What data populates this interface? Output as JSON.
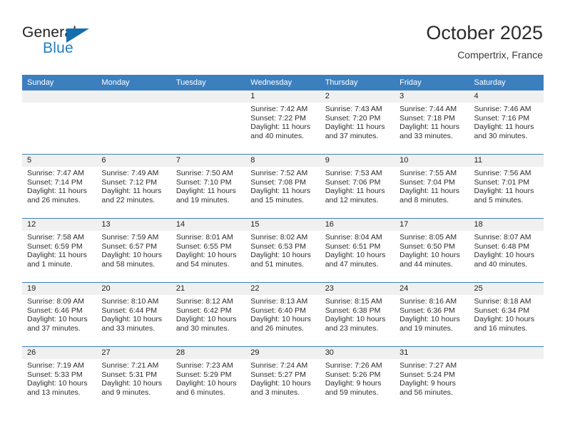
{
  "brand": {
    "name_part1": "General",
    "name_part2": "Blue",
    "flag_icon": "flag-icon"
  },
  "header": {
    "title": "October 2025",
    "subtitle": "Compertrix, France"
  },
  "calendar": {
    "weekday_headers": [
      "Sunday",
      "Monday",
      "Tuesday",
      "Wednesday",
      "Thursday",
      "Friday",
      "Saturday"
    ],
    "labels": {
      "sunrise": "Sunrise:",
      "sunset": "Sunset:",
      "daylight": "Daylight:"
    },
    "colors": {
      "header_bg": "#3c7fbf",
      "header_text": "#ffffff",
      "daynum_band": "#f0f0f0",
      "row_divider": "#3c7fbf",
      "brand_blue": "#1f7fc4"
    },
    "weeks": [
      [
        {
          "day": "",
          "empty": true
        },
        {
          "day": "",
          "empty": true
        },
        {
          "day": "",
          "empty": true
        },
        {
          "day": "1",
          "sunrise": "Sunrise: 7:42 AM",
          "sunset": "Sunset: 7:22 PM",
          "daylight_line1": "Daylight: 11 hours",
          "daylight_line2": "and 40 minutes."
        },
        {
          "day": "2",
          "sunrise": "Sunrise: 7:43 AM",
          "sunset": "Sunset: 7:20 PM",
          "daylight_line1": "Daylight: 11 hours",
          "daylight_line2": "and 37 minutes."
        },
        {
          "day": "3",
          "sunrise": "Sunrise: 7:44 AM",
          "sunset": "Sunset: 7:18 PM",
          "daylight_line1": "Daylight: 11 hours",
          "daylight_line2": "and 33 minutes."
        },
        {
          "day": "4",
          "sunrise": "Sunrise: 7:46 AM",
          "sunset": "Sunset: 7:16 PM",
          "daylight_line1": "Daylight: 11 hours",
          "daylight_line2": "and 30 minutes."
        }
      ],
      [
        {
          "day": "5",
          "sunrise": "Sunrise: 7:47 AM",
          "sunset": "Sunset: 7:14 PM",
          "daylight_line1": "Daylight: 11 hours",
          "daylight_line2": "and 26 minutes."
        },
        {
          "day": "6",
          "sunrise": "Sunrise: 7:49 AM",
          "sunset": "Sunset: 7:12 PM",
          "daylight_line1": "Daylight: 11 hours",
          "daylight_line2": "and 22 minutes."
        },
        {
          "day": "7",
          "sunrise": "Sunrise: 7:50 AM",
          "sunset": "Sunset: 7:10 PM",
          "daylight_line1": "Daylight: 11 hours",
          "daylight_line2": "and 19 minutes."
        },
        {
          "day": "8",
          "sunrise": "Sunrise: 7:52 AM",
          "sunset": "Sunset: 7:08 PM",
          "daylight_line1": "Daylight: 11 hours",
          "daylight_line2": "and 15 minutes."
        },
        {
          "day": "9",
          "sunrise": "Sunrise: 7:53 AM",
          "sunset": "Sunset: 7:06 PM",
          "daylight_line1": "Daylight: 11 hours",
          "daylight_line2": "and 12 minutes."
        },
        {
          "day": "10",
          "sunrise": "Sunrise: 7:55 AM",
          "sunset": "Sunset: 7:04 PM",
          "daylight_line1": "Daylight: 11 hours",
          "daylight_line2": "and 8 minutes."
        },
        {
          "day": "11",
          "sunrise": "Sunrise: 7:56 AM",
          "sunset": "Sunset: 7:01 PM",
          "daylight_line1": "Daylight: 11 hours",
          "daylight_line2": "and 5 minutes."
        }
      ],
      [
        {
          "day": "12",
          "sunrise": "Sunrise: 7:58 AM",
          "sunset": "Sunset: 6:59 PM",
          "daylight_line1": "Daylight: 11 hours",
          "daylight_line2": "and 1 minute."
        },
        {
          "day": "13",
          "sunrise": "Sunrise: 7:59 AM",
          "sunset": "Sunset: 6:57 PM",
          "daylight_line1": "Daylight: 10 hours",
          "daylight_line2": "and 58 minutes."
        },
        {
          "day": "14",
          "sunrise": "Sunrise: 8:01 AM",
          "sunset": "Sunset: 6:55 PM",
          "daylight_line1": "Daylight: 10 hours",
          "daylight_line2": "and 54 minutes."
        },
        {
          "day": "15",
          "sunrise": "Sunrise: 8:02 AM",
          "sunset": "Sunset: 6:53 PM",
          "daylight_line1": "Daylight: 10 hours",
          "daylight_line2": "and 51 minutes."
        },
        {
          "day": "16",
          "sunrise": "Sunrise: 8:04 AM",
          "sunset": "Sunset: 6:51 PM",
          "daylight_line1": "Daylight: 10 hours",
          "daylight_line2": "and 47 minutes."
        },
        {
          "day": "17",
          "sunrise": "Sunrise: 8:05 AM",
          "sunset": "Sunset: 6:50 PM",
          "daylight_line1": "Daylight: 10 hours",
          "daylight_line2": "and 44 minutes."
        },
        {
          "day": "18",
          "sunrise": "Sunrise: 8:07 AM",
          "sunset": "Sunset: 6:48 PM",
          "daylight_line1": "Daylight: 10 hours",
          "daylight_line2": "and 40 minutes."
        }
      ],
      [
        {
          "day": "19",
          "sunrise": "Sunrise: 8:09 AM",
          "sunset": "Sunset: 6:46 PM",
          "daylight_line1": "Daylight: 10 hours",
          "daylight_line2": "and 37 minutes."
        },
        {
          "day": "20",
          "sunrise": "Sunrise: 8:10 AM",
          "sunset": "Sunset: 6:44 PM",
          "daylight_line1": "Daylight: 10 hours",
          "daylight_line2": "and 33 minutes."
        },
        {
          "day": "21",
          "sunrise": "Sunrise: 8:12 AM",
          "sunset": "Sunset: 6:42 PM",
          "daylight_line1": "Daylight: 10 hours",
          "daylight_line2": "and 30 minutes."
        },
        {
          "day": "22",
          "sunrise": "Sunrise: 8:13 AM",
          "sunset": "Sunset: 6:40 PM",
          "daylight_line1": "Daylight: 10 hours",
          "daylight_line2": "and 26 minutes."
        },
        {
          "day": "23",
          "sunrise": "Sunrise: 8:15 AM",
          "sunset": "Sunset: 6:38 PM",
          "daylight_line1": "Daylight: 10 hours",
          "daylight_line2": "and 23 minutes."
        },
        {
          "day": "24",
          "sunrise": "Sunrise: 8:16 AM",
          "sunset": "Sunset: 6:36 PM",
          "daylight_line1": "Daylight: 10 hours",
          "daylight_line2": "and 19 minutes."
        },
        {
          "day": "25",
          "sunrise": "Sunrise: 8:18 AM",
          "sunset": "Sunset: 6:34 PM",
          "daylight_line1": "Daylight: 10 hours",
          "daylight_line2": "and 16 minutes."
        }
      ],
      [
        {
          "day": "26",
          "sunrise": "Sunrise: 7:19 AM",
          "sunset": "Sunset: 5:33 PM",
          "daylight_line1": "Daylight: 10 hours",
          "daylight_line2": "and 13 minutes."
        },
        {
          "day": "27",
          "sunrise": "Sunrise: 7:21 AM",
          "sunset": "Sunset: 5:31 PM",
          "daylight_line1": "Daylight: 10 hours",
          "daylight_line2": "and 9 minutes."
        },
        {
          "day": "28",
          "sunrise": "Sunrise: 7:23 AM",
          "sunset": "Sunset: 5:29 PM",
          "daylight_line1": "Daylight: 10 hours",
          "daylight_line2": "and 6 minutes."
        },
        {
          "day": "29",
          "sunrise": "Sunrise: 7:24 AM",
          "sunset": "Sunset: 5:27 PM",
          "daylight_line1": "Daylight: 10 hours",
          "daylight_line2": "and 3 minutes."
        },
        {
          "day": "30",
          "sunrise": "Sunrise: 7:26 AM",
          "sunset": "Sunset: 5:26 PM",
          "daylight_line1": "Daylight: 9 hours",
          "daylight_line2": "and 59 minutes."
        },
        {
          "day": "31",
          "sunrise": "Sunrise: 7:27 AM",
          "sunset": "Sunset: 5:24 PM",
          "daylight_line1": "Daylight: 9 hours",
          "daylight_line2": "and 56 minutes."
        },
        {
          "day": "",
          "empty": true
        }
      ]
    ]
  }
}
